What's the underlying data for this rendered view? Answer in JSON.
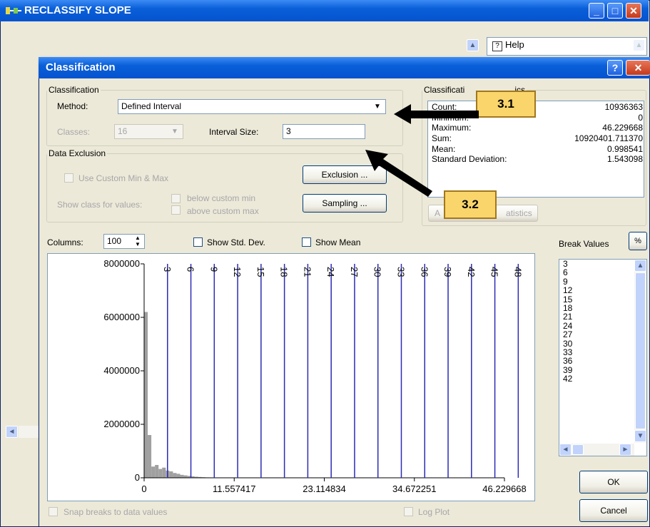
{
  "outer_window": {
    "title": "RECLASSIFY SLOPE",
    "help_label": "Help"
  },
  "dialog": {
    "title": "Classification"
  },
  "classification": {
    "group_label": "Classification",
    "method_label": "Method:",
    "method_value": "Defined Interval",
    "classes_label": "Classes:",
    "classes_value": "16",
    "interval_label": "Interval Size:",
    "interval_value": "3"
  },
  "exclusion": {
    "group_label": "Data Exclusion",
    "use_custom_label": "Use Custom Min & Max",
    "show_class_label": "Show class for values:",
    "below_label": "below custom min",
    "above_label": "above custom max",
    "exclusion_button": "Exclusion ...",
    "sampling_button": "Sampling ..."
  },
  "stats": {
    "group_label": "Classificati",
    "group_label_tail": "ics",
    "rows": [
      {
        "label": "Count:",
        "value": "10936363"
      },
      {
        "label": "Minimum:",
        "value": "0"
      },
      {
        "label": "Maximum:",
        "value": "46.229668"
      },
      {
        "label": "Sum:",
        "value": "10920401.711370"
      },
      {
        "label": "Mean:",
        "value": "0.998541"
      },
      {
        "label": "Standard Deviation:",
        "value": "1.543098"
      }
    ],
    "button_label_left": "A",
    "button_label_right": "atistics"
  },
  "callouts": {
    "a": "3.1",
    "b": "3.2"
  },
  "columns": {
    "label": "Columns:",
    "value": "100"
  },
  "show_std_label": "Show Std. Dev.",
  "show_mean_label": "Show Mean",
  "break_values": {
    "header": "Break Values",
    "percent_button": "%",
    "items": [
      "3",
      "6",
      "9",
      "12",
      "15",
      "18",
      "21",
      "24",
      "27",
      "30",
      "33",
      "36",
      "39",
      "42"
    ]
  },
  "snap_label": "Snap breaks to data values",
  "log_plot_label": "Log Plot",
  "ok_label": "OK",
  "cancel_label": "Cancel",
  "chart_data": {
    "type": "bar",
    "y_ticks": [
      "8000000",
      "6000000",
      "4000000",
      "2000000",
      "0"
    ],
    "y_max": 8000000,
    "x_ticks": [
      "0",
      "11.557417",
      "23.114834",
      "34.672251",
      "46.229668"
    ],
    "x_min": 0,
    "x_max": 46.229668,
    "break_values": [
      3,
      6,
      9,
      12,
      15,
      18,
      21,
      24,
      27,
      30,
      33,
      36,
      39,
      42,
      45,
      48
    ],
    "histogram_values": [
      6200000,
      1600000,
      420000,
      480000,
      330000,
      380000,
      270000,
      240000,
      180000,
      150000,
      110000,
      90000,
      70000,
      55000,
      40000,
      30000,
      22000,
      15000,
      10000,
      6000
    ],
    "histogram_bin_width": 0.462297,
    "bar_color": "#a0a0a0",
    "break_line_color": "#2b2bb5"
  }
}
